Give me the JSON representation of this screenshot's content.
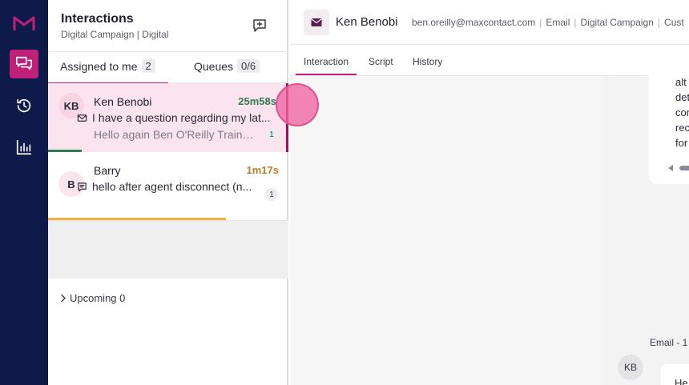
{
  "nav": {
    "items": [
      {
        "name": "interactions",
        "icon": "chat-bubbles-icon",
        "active": true
      },
      {
        "name": "history",
        "icon": "history-icon",
        "active": false
      },
      {
        "name": "reports",
        "icon": "bar-chart-icon",
        "active": false
      }
    ],
    "brand_color": "#c0207a",
    "background": "#0d1a4a"
  },
  "panel": {
    "title": "Interactions",
    "subtitle": "Digital Campaign | Digital",
    "tabs": [
      {
        "label": "Assigned to me",
        "count": "2",
        "active": true
      },
      {
        "label": "Queues",
        "count": "0/6",
        "active": false
      }
    ],
    "items": [
      {
        "initials": "KB",
        "name": "Ken Benobi",
        "time": "25m58s",
        "channel_icon": "mail-icon",
        "subject": "I have a question regarding my lat...",
        "preview": "Hello again Ben O'Reilly Traini...",
        "badge": "1",
        "time_color": "#2e7d4f",
        "progress_color": "#2e7d4f",
        "progress": 0.14,
        "selected": true
      },
      {
        "initials": "B",
        "name": "Barry",
        "time": "1m17s",
        "channel_icon": "chat-icon",
        "subject": "hello after agent disconnect (n...",
        "preview": "",
        "badge": "1",
        "time_color": "#b8802a",
        "progress_color": "#f0b540",
        "progress": 0.74,
        "selected": false
      }
    ],
    "upcoming": "Upcoming 0"
  },
  "main": {
    "contact_name": "Ken Benobi",
    "contact_meta": [
      "ben.oreilly@maxcontact.com",
      "Email",
      "Digital Campaign",
      "Cust"
    ],
    "tabs": [
      {
        "label": "Interaction",
        "active": true
      },
      {
        "label": "Script",
        "active": false
      },
      {
        "label": "History",
        "active": false
      }
    ],
    "message_fragments": [
      "alt",
      "det",
      "cor",
      "rec",
      "for"
    ],
    "email_label": "Email - 1",
    "sender_initials": "KB",
    "email_card_text": "He"
  }
}
